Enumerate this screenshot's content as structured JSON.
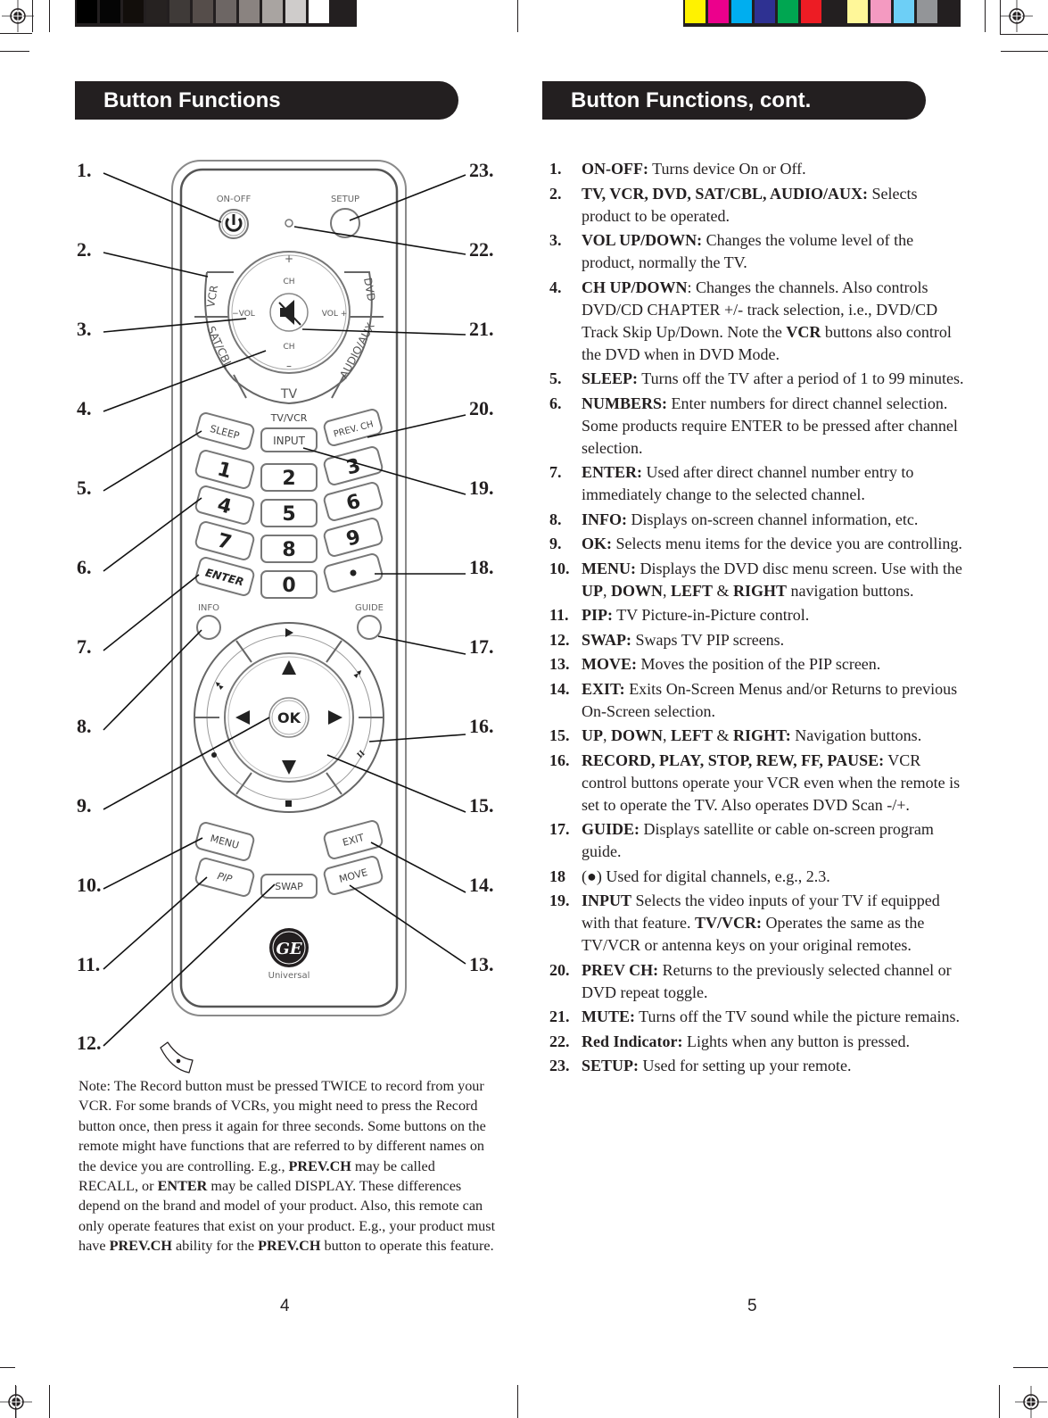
{
  "print_marks": {
    "grayscale_swatches": [
      "#000000",
      "#050505",
      "#120e0b",
      "#262221",
      "#3f3a38",
      "#554d4a",
      "#6d6664",
      "#8a8380",
      "#a9a4a1",
      "#cfcccb",
      "#ffffff"
    ],
    "color_swatches": [
      "#fff200",
      "#ec008c",
      "#00aeef",
      "#2e3192",
      "#00a651",
      "#ed1c24",
      "#231f20",
      "#fff799",
      "#f49ac1",
      "#6dcff6",
      "#939598"
    ]
  },
  "left_page": {
    "title": "Button Functions",
    "page_number": "4",
    "callouts_left": [
      "1.",
      "2.",
      "3.",
      "4.",
      "5.",
      "6.",
      "7.",
      "8.",
      "9.",
      "10.",
      "11.",
      "12."
    ],
    "callouts_right": [
      "23.",
      "22.",
      "21.",
      "20.",
      "19.",
      "18.",
      "17.",
      "16.",
      "15.",
      "14.",
      "13."
    ],
    "remote": {
      "on_off": "ON-OFF",
      "setup": "SETUP",
      "vcr": "VCR",
      "dvd": "DVD",
      "sat_cbl": "SAT/CBL",
      "audio_aux": "AUDIO/AUX",
      "tv": "TV",
      "ch": "CH",
      "vol_minus": "−VOL",
      "vol_plus": "VOL +",
      "plus": "+",
      "minus": "–",
      "sleep": "SLEEP",
      "tv_vcr": "TV/VCR",
      "input": "INPUT",
      "prev_ch": "PREV. CH",
      "digits": [
        "1",
        "2",
        "3",
        "4",
        "5",
        "6",
        "7",
        "8",
        "9",
        "0"
      ],
      "enter": "ENTER",
      "dot": "•",
      "info": "INFO",
      "guide": "GUIDE",
      "ok": "OK",
      "menu": "MENU",
      "exit": "EXIT",
      "pip": "PIP",
      "swap": "SWAP",
      "move": "MOVE",
      "brand": "Universal",
      "logo_text": "GE"
    },
    "note": {
      "p1": "Note: The Record button must be pressed TWICE to record from your VCR. For some brands of VCRs, you might need to press the Record button once, then press it again for three seconds. Some buttons on the remote might have functions that are referred to by different names on the device you are controlling. E.g., ",
      "b1": "PREV.CH",
      "p2": " may be called RECALL, or ",
      "b2": "ENTER",
      "p3": " may be called DISPLAY. These differences depend on the brand and model of your product. Also, this remote can only operate features that exist on your product. E.g., your product must have ",
      "b3": "PREV.CH",
      "p4": " ability for the ",
      "b4": "PREV.CH",
      "p5": " button to operate this feature."
    }
  },
  "right_page": {
    "title": "Button Functions, cont.",
    "page_number": "5",
    "items": [
      {
        "n": "1.",
        "parts": [
          {
            "b": "ON-OFF:"
          },
          {
            "t": " Turns device On or Off."
          }
        ]
      },
      {
        "n": "2.",
        "parts": [
          {
            "b": "TV, VCR, DVD, SAT/CBL, AUDIO/AUX:"
          },
          {
            "t": " Selects product to be operated."
          }
        ]
      },
      {
        "n": "3.",
        "parts": [
          {
            "b": "VOL UP/DOWN:"
          },
          {
            "t": " Changes the volume level of the product, normally the TV."
          }
        ]
      },
      {
        "n": "4.",
        "parts": [
          {
            "b": "CH UP/DOWN"
          },
          {
            "t": ": Changes the channels. Also controls DVD/CD CHAPTER +/- track selection, i.e., DVD/CD Track Skip Up/Down. Note the "
          },
          {
            "b": "VCR"
          },
          {
            "t": " buttons also control the DVD when in DVD Mode."
          }
        ]
      },
      {
        "n": "5.",
        "parts": [
          {
            "b": "SLEEP:"
          },
          {
            "t": " Turns off the TV after a period of 1 to 99 minutes."
          }
        ]
      },
      {
        "n": "6.",
        "parts": [
          {
            "b": "NUMBERS:"
          },
          {
            "t": " Enter numbers for direct channel selection. Some products require ENTER to be pressed after channel selection."
          }
        ]
      },
      {
        "n": "7.",
        "parts": [
          {
            "b": "ENTER:"
          },
          {
            "t": " Used after direct channel number entry to immediately change to the selected channel."
          }
        ]
      },
      {
        "n": "8.",
        "parts": [
          {
            "b": "INFO:"
          },
          {
            "t": " Displays on-screen channel information, etc."
          }
        ]
      },
      {
        "n": "9.",
        "parts": [
          {
            "b": "OK:"
          },
          {
            "t": " Selects menu items for the device you are controlling."
          }
        ]
      },
      {
        "n": "10.",
        "parts": [
          {
            "b": "MENU:"
          },
          {
            "t": " Displays the DVD disc menu screen. Use with the "
          },
          {
            "b": "UP"
          },
          {
            "t": ", "
          },
          {
            "b": "DOWN"
          },
          {
            "t": ", "
          },
          {
            "b": "LEFT"
          },
          {
            "t": " & "
          },
          {
            "b": "RIGHT"
          },
          {
            "t": " navigation buttons."
          }
        ]
      },
      {
        "n": "11.",
        "parts": [
          {
            "b": "PIP:"
          },
          {
            "t": " TV Picture-in-Picture control."
          }
        ]
      },
      {
        "n": "12.",
        "parts": [
          {
            "b": "SWAP:"
          },
          {
            "t": " Swaps TV PIP screens."
          }
        ]
      },
      {
        "n": "13.",
        "parts": [
          {
            "b": "MOVE:"
          },
          {
            "t": " Moves the position of the PIP screen."
          }
        ]
      },
      {
        "n": "14.",
        "parts": [
          {
            "b": "EXIT:"
          },
          {
            "t": " Exits On-Screen Menus and/or Returns to previous On-Screen selection."
          }
        ]
      },
      {
        "n": "15.",
        "parts": [
          {
            "b": "UP"
          },
          {
            "t": ", "
          },
          {
            "b": "DOWN"
          },
          {
            "t": ", "
          },
          {
            "b": "LEFT"
          },
          {
            "t": " & "
          },
          {
            "b": "RIGHT:"
          },
          {
            "t": " Navigation buttons."
          }
        ]
      },
      {
        "n": "16.",
        "parts": [
          {
            "b": "RECORD, PLAY, STOP, REW, FF, PAUSE:"
          },
          {
            "t": "  VCR control buttons operate your VCR even when the remote is set to operate the TV. Also operates DVD Scan -/+."
          }
        ]
      },
      {
        "n": "17.",
        "parts": [
          {
            "b": "GUIDE:"
          },
          {
            "t": " Displays satellite or cable on-screen program guide."
          }
        ]
      },
      {
        "n": "18",
        "parts": [
          {
            "t": "(●) Used for digital channels, e.g., 2.3."
          }
        ]
      },
      {
        "n": "19.",
        "parts": [
          {
            "b": "INPUT"
          },
          {
            "t": " Selects the video inputs of your TV if equipped with that feature. "
          },
          {
            "b": "TV/VCR:"
          },
          {
            "t": " Operates the same as the TV/VCR or antenna keys on your original remotes."
          }
        ]
      },
      {
        "n": "20.",
        "parts": [
          {
            "b": "PREV CH:"
          },
          {
            "t": " Returns to the previously selected channel or DVD repeat toggle."
          }
        ]
      },
      {
        "n": "21.",
        "parts": [
          {
            "b": "MUTE:"
          },
          {
            "t": " Turns off the TV sound while the picture remains."
          }
        ]
      },
      {
        "n": "22.",
        "parts": [
          {
            "b": "Red Indicator:"
          },
          {
            "t": " Lights when any button is pressed."
          }
        ]
      },
      {
        "n": "23.",
        "parts": [
          {
            "b": "SETUP:"
          },
          {
            "t": " Used for setting up your remote."
          }
        ]
      }
    ]
  }
}
